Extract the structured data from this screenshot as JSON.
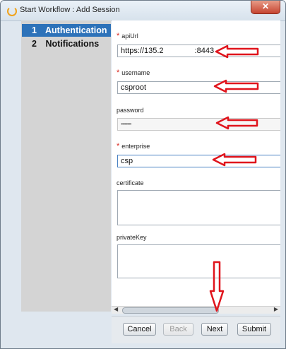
{
  "window": {
    "title": "Start Workflow : Add Session",
    "close_label": "✕"
  },
  "sidebar": {
    "items": [
      {
        "number": "1",
        "label": "Authentication",
        "active": true
      },
      {
        "number": "2",
        "label": "Notifications",
        "active": false
      }
    ]
  },
  "form": {
    "required_mark": "*",
    "api_url": {
      "label": "apiUrl",
      "value": "https://135.2",
      "value_suffix": ":8443"
    },
    "username": {
      "label": "username",
      "value": "csproot"
    },
    "password": {
      "label": "password",
      "value": "••••••••"
    },
    "enterprise": {
      "label": "enterprise",
      "value": "csp"
    },
    "certificate": {
      "label": "certificate"
    },
    "private_key": {
      "label": "privateKey"
    }
  },
  "buttons": {
    "cancel": "Cancel",
    "back": "Back",
    "next": "Next",
    "submit": "Submit"
  },
  "colors": {
    "annotation": "#e0141c",
    "active_nav": "#2d72b9",
    "required": "#d9251c"
  }
}
